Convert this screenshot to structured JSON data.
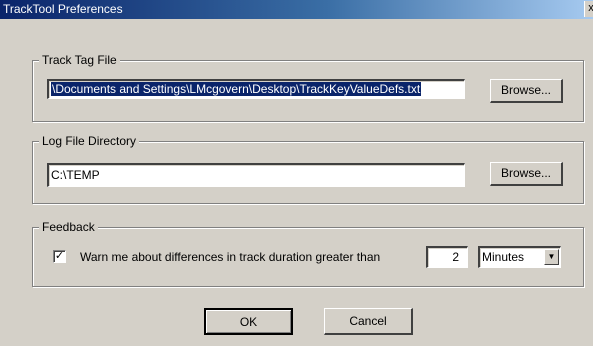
{
  "window": {
    "title": "TrackTool Preferences",
    "close_glyph": "x"
  },
  "track_tag": {
    "legend": "Track Tag File",
    "value": "\\Documents and Settings\\LMcgovern\\Desktop\\TrackKeyValueDefs.txt",
    "browse_label": "Browse..."
  },
  "log_dir": {
    "legend": "Log File Directory",
    "value": "C:\\TEMP",
    "browse_label": "Browse..."
  },
  "feedback": {
    "legend": "Feedback",
    "checkbox_checked": true,
    "check_glyph": "✓",
    "warn_label": "Warn me about differences in track duration greater than",
    "duration_value": "2",
    "unit_selected": "Minutes",
    "dropdown_glyph": "▼"
  },
  "buttons": {
    "ok_label": "OK",
    "cancel_label": "Cancel"
  }
}
